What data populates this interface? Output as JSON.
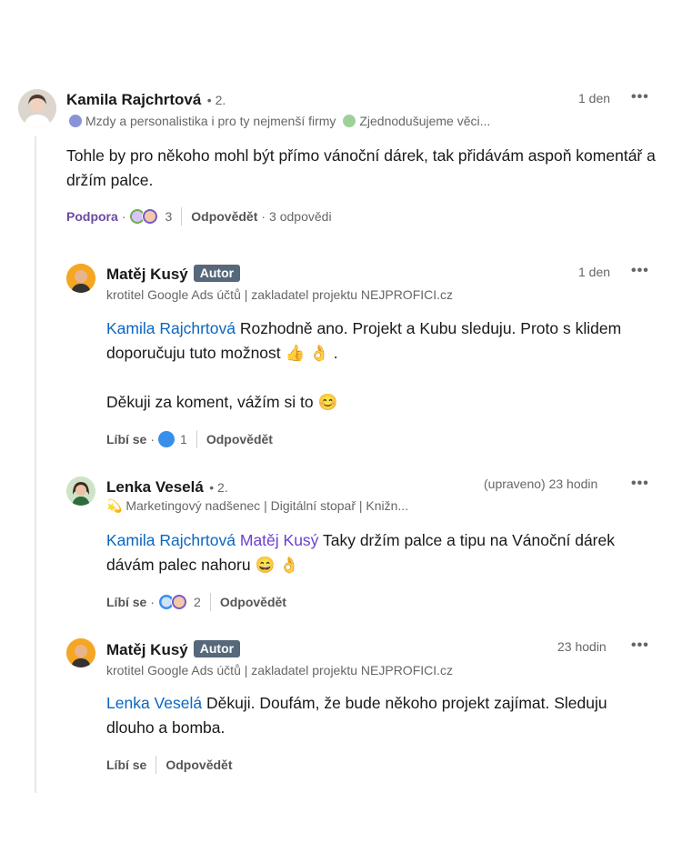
{
  "thread": {
    "comment": {
      "author": "Kamila Rajchrtová",
      "degree": "• 2.",
      "group1": "Mzdy a personalistika i pro ty nejmenší firmy",
      "group2": "Zjednodušujeme věci...",
      "time": "1 den",
      "text": "Tohle by pro někoho mohl být přímo vánoční dárek, tak přidávám aspoň komentář a držím palce.",
      "support_label": "Podpora",
      "reaction_count": "3",
      "reply_label": "Odpovědět",
      "replies_count": "3 odpovědi"
    },
    "replies": [
      {
        "author": "Matěj Kusý",
        "badge": "Autor",
        "headline": "krotitel Google Ads účtů | zakladatel projektu NEJPROFICI.cz",
        "time": "1 den",
        "mention": "Kamila Rajchrtová",
        "text_line1": "Rozhodně ano. Projekt a Kubu sleduju. Proto s klidem",
        "text_line2": "doporučuju tuto možnost 👍 👌 .",
        "text_line3": "Děkuji za koment, vážím si to 😊",
        "like_label": "Líbí se",
        "reaction_count": "1",
        "reply_label": "Odpovědět"
      },
      {
        "author": "Lenka Veselá",
        "degree": "• 2.",
        "headline": "💫 Marketingový nadšenec | Digitální stopař | Knižn...",
        "time": "(upraveno) 23 hodin",
        "mention1": "Kamila Rajchrtová",
        "mention2": "Matěj Kusý",
        "text_line1": "Taky držím palce a tipu na Vánoční dárek",
        "text_line2": "dávám palec nahoru 😄 👌",
        "like_label": "Líbí se",
        "reaction_count": "2",
        "reply_label": "Odpovědět"
      },
      {
        "author": "Matěj Kusý",
        "badge": "Autor",
        "headline": "krotitel Google Ads účtů | zakladatel projektu NEJPROFICI.cz",
        "time": "23 hodin",
        "mention": "Lenka Veselá",
        "text_line1": "Děkuji. Doufám, že bude někoho projekt zajímat. Sleduju",
        "text_line2": "dlouho a bomba.",
        "like_label": "Líbí se",
        "reply_label": "Odpovědět"
      }
    ]
  },
  "icons": {
    "more": "more-options-icon",
    "support_reaction": "support-reaction-icon",
    "like_reaction": "like-reaction-icon"
  },
  "colors": {
    "mention": "#0a66c2",
    "mention_purple": "#6c3fd1",
    "badge_bg": "#56687a",
    "support": "#6b4aa1"
  }
}
